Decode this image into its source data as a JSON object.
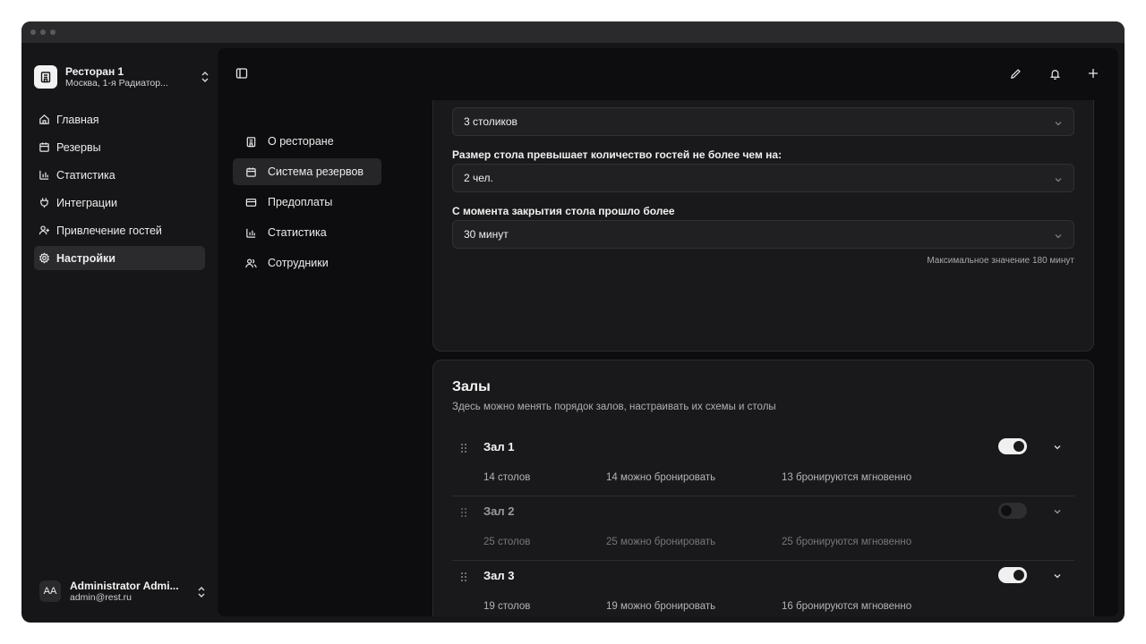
{
  "restaurant": {
    "name": "Ресторан 1",
    "address": "Москва, 1-я Радиатор..."
  },
  "nav": [
    {
      "label": "Главная",
      "icon": "home-icon"
    },
    {
      "label": "Резервы",
      "icon": "calendar-icon"
    },
    {
      "label": "Статистика",
      "icon": "bar-chart-icon"
    },
    {
      "label": "Интеграции",
      "icon": "plug-icon"
    },
    {
      "label": "Привлечение гостей",
      "icon": "user-plus-icon"
    },
    {
      "label": "Настройки",
      "icon": "gear-icon",
      "active": true
    }
  ],
  "user": {
    "initials": "AA",
    "name": "Administrator Admi...",
    "email": "admin@rest.ru"
  },
  "settings_nav": [
    {
      "label": "О ресторане",
      "icon": "building-icon"
    },
    {
      "label": "Система резервов",
      "icon": "calendar-icon",
      "active": true
    },
    {
      "label": "Предоплаты",
      "icon": "card-icon"
    },
    {
      "label": "Статистика",
      "icon": "bar-chart-icon"
    },
    {
      "label": "Сотрудники",
      "icon": "users-icon"
    }
  ],
  "reserve_settings": {
    "tables_select": "3 столиков",
    "size_label": "Размер стола превышает количество гостей не более чем на:",
    "size_select": "2 чел.",
    "closing_label": "С момента закрытия стола прошло более",
    "closing_select": "30 минут",
    "closing_hint": "Максимальное значение 180 минут"
  },
  "halls": {
    "title": "Залы",
    "subtitle": "Здесь можно менять порядок залов, настраивать их схемы и столы",
    "items": [
      {
        "name": "Зал 1",
        "enabled": true,
        "tables": "14 столов",
        "bookable": "14 можно бронировать",
        "instant": "13 бронируются мгновенно"
      },
      {
        "name": "Зал 2",
        "enabled": false,
        "tables": "25 столов",
        "bookable": "25 можно бронировать",
        "instant": "25 бронируются мгновенно"
      },
      {
        "name": "Зал 3",
        "enabled": true,
        "tables": "19 столов",
        "bookable": "19 можно бронировать",
        "instant": "16 бронируются мгновенно"
      }
    ]
  },
  "colors": {
    "background": "#161618",
    "panel": "#0d0d0f",
    "card": "#19191b",
    "toggle_on": "#f0f0f0"
  }
}
